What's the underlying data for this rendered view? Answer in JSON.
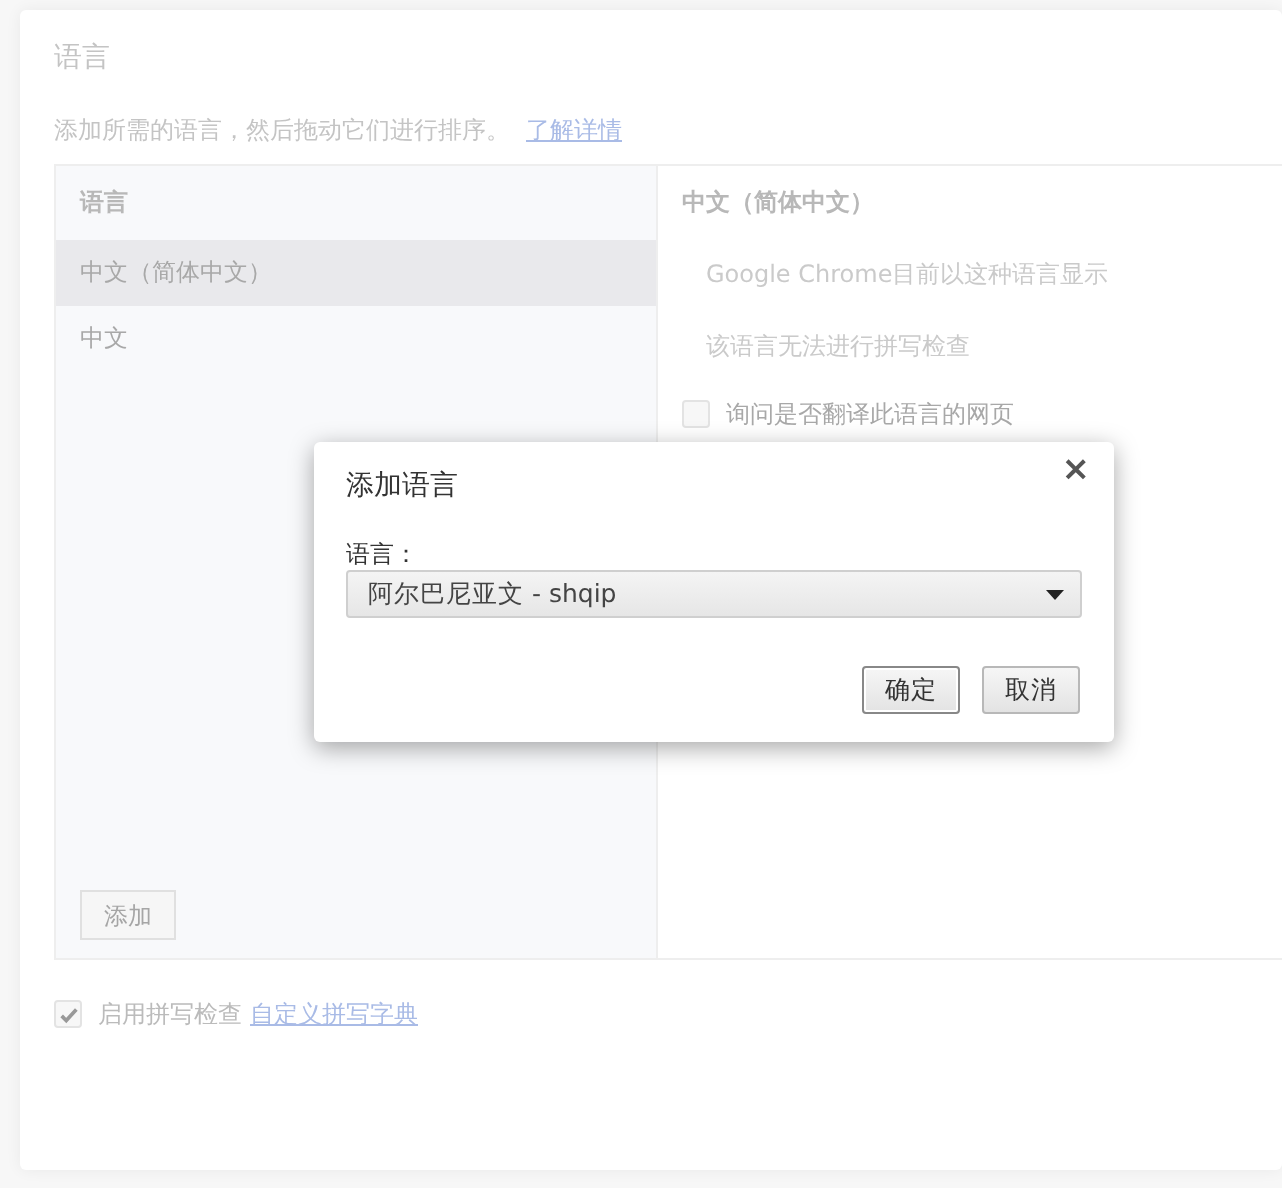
{
  "page": {
    "title": "语言",
    "description": "添加所需的语言，然后拖动它们进行排序。",
    "learn_more": "了解详情"
  },
  "languages": {
    "header": "语言",
    "items": [
      {
        "label": "中文（简体中文）",
        "selected": true
      },
      {
        "label": "中文",
        "selected": false
      }
    ],
    "add_button": "添加"
  },
  "details": {
    "header": "中文（简体中文）",
    "lines": [
      "Google Chrome目前以这种语言显示",
      "该语言无法进行拼写检查"
    ],
    "translate": {
      "label": "询问是否翻译此语言的网页",
      "checked": false
    }
  },
  "spellcheck": {
    "label": "启用拼写检查",
    "checked": true,
    "link": "自定义拼写字典"
  },
  "dialog": {
    "title": "添加语言",
    "close": "×",
    "field_label": "语言：",
    "value": "阿尔巴尼亚文 - shqip",
    "buttons": [
      {
        "label": "确定",
        "kind": "default"
      },
      {
        "label": "取消",
        "kind": "plain"
      }
    ]
  }
}
